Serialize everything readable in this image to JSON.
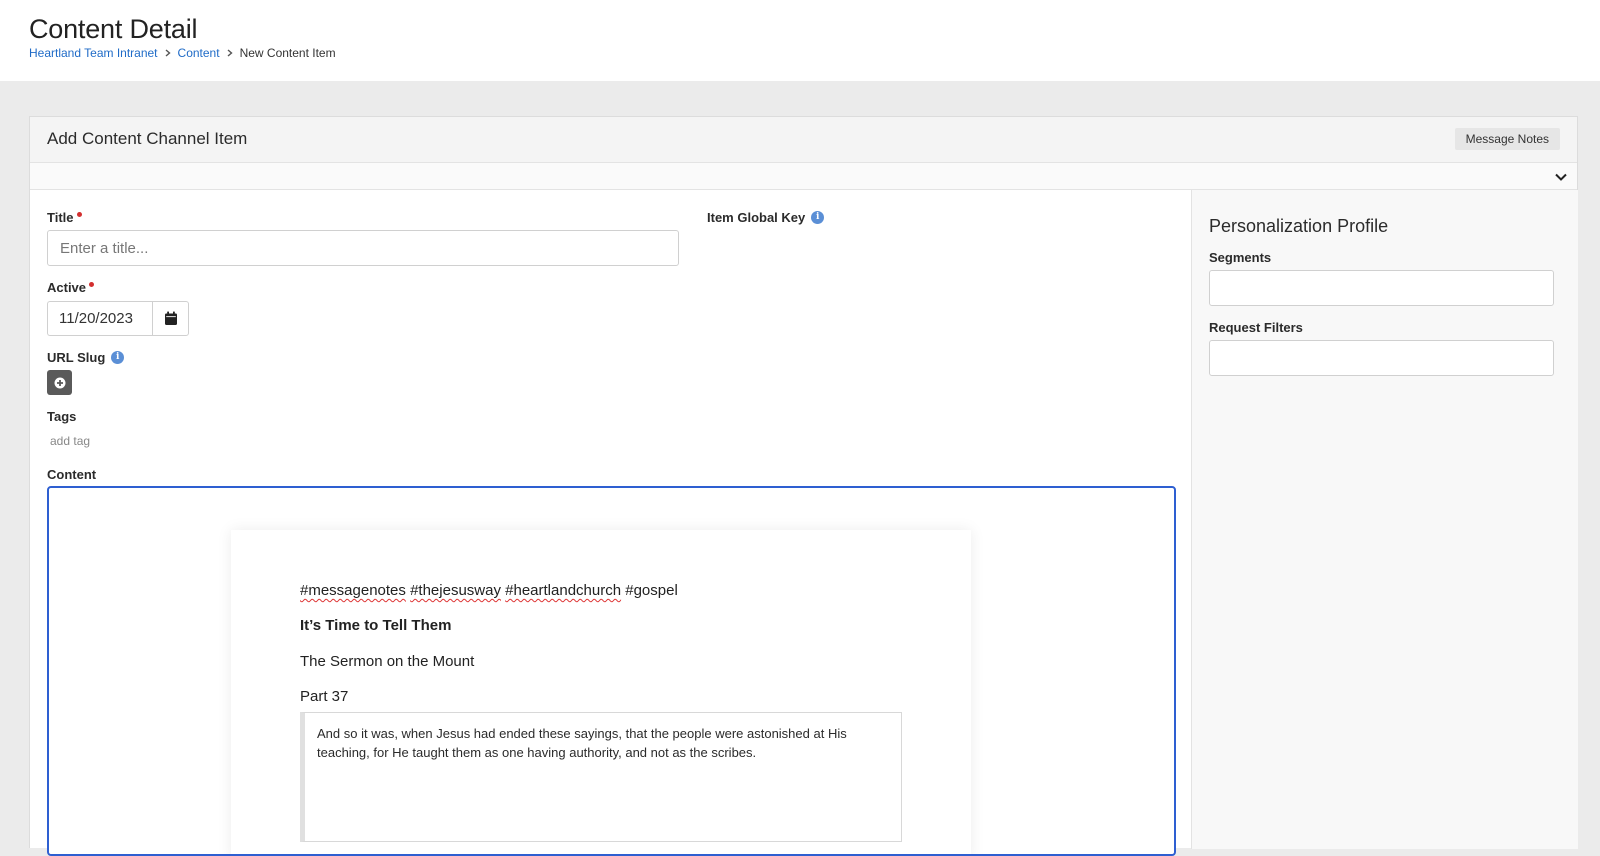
{
  "header": {
    "title": "Content Detail",
    "breadcrumb": [
      "Heartland Team Intranet",
      "Content",
      "New Content Item"
    ]
  },
  "panel": {
    "title": "Add Content Channel Item",
    "badge": "Message Notes"
  },
  "form": {
    "title_label": "Title",
    "title_placeholder": "Enter a title...",
    "title_value": "",
    "active_label": "Active",
    "active_value": "11/20/2023",
    "url_slug_label": "URL Slug",
    "tags_label": "Tags",
    "add_tag_text": "add tag",
    "content_label": "Content",
    "global_key_label": "Item Global Key"
  },
  "content": {
    "tags_parts": [
      "#messagenotes",
      "#thejesusway",
      "#heartlandchurch",
      "#gospel"
    ],
    "heading": "It’s Time to Tell Them",
    "line1": "The Sermon on the Mount",
    "line2": "Part 37",
    "quote": "And so it was, when Jesus had ended these sayings, that the people were astonished at His teaching, for He taught them as one having authority, and not as the scribes."
  },
  "sidebar": {
    "title": "Personalization Profile",
    "segments_label": "Segments",
    "request_filters_label": "Request Filters"
  },
  "colors": {
    "link": "#1f6bc7",
    "required": "#d32f2f",
    "focus_border": "#2e5fd1",
    "info_icon": "#5b8fd6"
  }
}
